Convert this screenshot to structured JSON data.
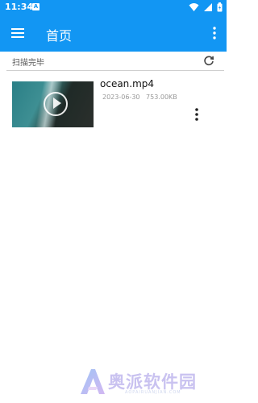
{
  "status_bar": {
    "time": "11:34",
    "notification_letter": "A",
    "icons": [
      "wifi-icon",
      "signal-icon",
      "battery-icon"
    ]
  },
  "app_bar": {
    "title": "首页",
    "left_icon": "menu-icon",
    "right_icon": "more-vert-icon"
  },
  "scan": {
    "status_text": "扫描完毕",
    "icon": "refresh-icon"
  },
  "files": [
    {
      "name": "ocean.mp4",
      "date": "2023-06-30",
      "size": "753.00KB",
      "thumbnail": "ocean-coast-thumbnail",
      "menu_icon": "more-vert-icon"
    }
  ],
  "watermark": {
    "brand": "奥派软件园",
    "sub": "AOPAIRUANJIAN.COM"
  },
  "colors": {
    "primary": "#1296f3",
    "background": "#ffffff",
    "meta_text": "#999999"
  }
}
